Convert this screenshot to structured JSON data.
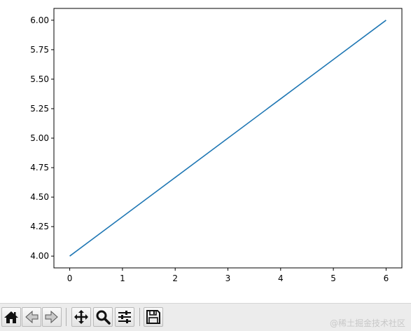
{
  "chart_data": {
    "type": "line",
    "x": [
      0,
      1,
      2,
      3,
      4,
      5,
      6
    ],
    "series": [
      {
        "values": [
          4.0,
          4.3333,
          4.6667,
          5.0,
          5.3333,
          5.6667,
          6.0
        ],
        "color": "#1f77b4"
      }
    ],
    "xlim": [
      -0.3,
      6.3
    ],
    "ylim": [
      3.9,
      6.1
    ],
    "xticks": [
      "0",
      "1",
      "2",
      "3",
      "4",
      "5",
      "6"
    ],
    "xtick_values": [
      0,
      1,
      2,
      3,
      4,
      5,
      6
    ],
    "yticks": [
      "4.00",
      "4.25",
      "4.50",
      "4.75",
      "5.00",
      "5.25",
      "5.50",
      "5.75",
      "6.00"
    ],
    "ytick_values": [
      4.0,
      4.25,
      4.5,
      4.75,
      5.0,
      5.25,
      5.5,
      5.75,
      6.0
    ],
    "title": "",
    "xlabel": "",
    "ylabel": "",
    "grid": false,
    "legend": "none"
  },
  "toolbar": {
    "buttons": [
      {
        "name": "home-button",
        "icon": "home-icon"
      },
      {
        "name": "back-button",
        "icon": "arrow-left-icon"
      },
      {
        "name": "forward-button",
        "icon": "arrow-right-icon"
      },
      {
        "name": "pan-button",
        "icon": "move-icon"
      },
      {
        "name": "zoom-button",
        "icon": "magnifier-icon"
      },
      {
        "name": "configure-subplots-button",
        "icon": "sliders-icon"
      },
      {
        "name": "save-button",
        "icon": "floppy-disk-icon"
      }
    ]
  },
  "watermark": "@稀土掘金技术社区"
}
